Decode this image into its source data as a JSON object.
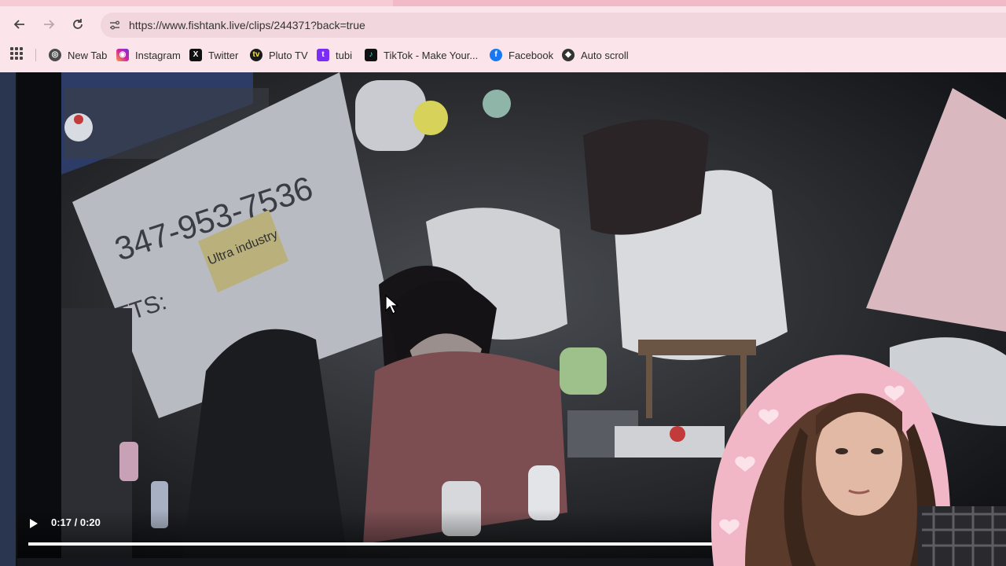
{
  "browser": {
    "url": "https://www.fishtank.live/clips/244371?back=true",
    "nav": {
      "back_icon": "arrow-left-icon",
      "forward_icon": "arrow-right-icon",
      "reload_icon": "reload-icon",
      "site_info_icon": "tune-icon"
    },
    "bookmarks": [
      {
        "label": "New Tab",
        "icon": "chrome-icon",
        "color": "#4a4a4a"
      },
      {
        "label": "Instagram",
        "icon": "instagram-icon",
        "color": "#d6249f"
      },
      {
        "label": "Twitter",
        "icon": "x-icon",
        "color": "#111111"
      },
      {
        "label": "Pluto TV",
        "icon": "pluto-tv-icon",
        "color": "#1a1a1a"
      },
      {
        "label": "tubi",
        "icon": "tubi-icon",
        "color": "#7b2cf5"
      },
      {
        "label": "TikTok - Make Your...",
        "icon": "tiktok-icon",
        "color": "#111111"
      },
      {
        "label": "Facebook",
        "icon": "facebook-icon",
        "color": "#1877f2"
      },
      {
        "label": "Auto scroll",
        "icon": "auto-scroll-icon",
        "color": "#333333"
      }
    ]
  },
  "player": {
    "time": "0:17 / 0:20",
    "progress": 0.85,
    "whiteboard_text": {
      "phone": "347-953-7536",
      "sticky_note": "Ultra industry",
      "tts": "TTS:"
    }
  },
  "colors": {
    "chrome_bg": "#fbe4ea",
    "tab_strip": "#f6cbd6",
    "address_bg": "#f1d6dd",
    "sidebar": "#2a3550"
  }
}
